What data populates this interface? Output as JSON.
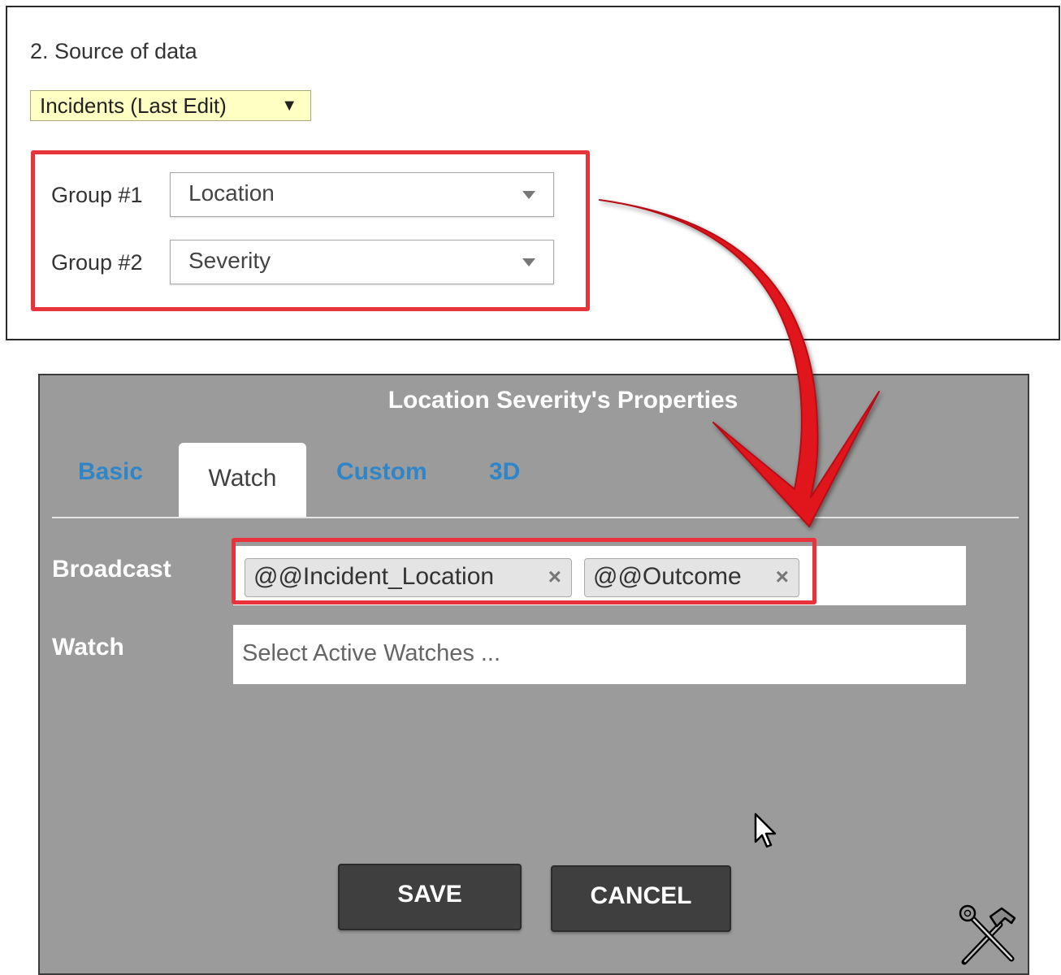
{
  "source_panel": {
    "section_title": "2. Source of data",
    "source_select_value": "Incidents (Last Edit)",
    "source_select_arrow": "▼",
    "group1_label": "Group #1",
    "group1_value": "Location",
    "group2_label": "Group #2",
    "group2_value": "Severity",
    "highlight_color": "#e8333d",
    "source_select_bg": "#ffffc4"
  },
  "dialog": {
    "title": "Location Severity's Properties",
    "tabs": [
      {
        "label": "Basic",
        "active": false
      },
      {
        "label": "Watch",
        "active": true
      },
      {
        "label": "Custom",
        "active": false
      },
      {
        "label": "3D",
        "active": false
      }
    ],
    "tab_color": "#2e86c9",
    "broadcast_label": "Broadcast",
    "broadcast_tags": [
      {
        "label": "@@Incident_Location",
        "remove": "×"
      },
      {
        "label": "@@Outcome",
        "remove": "×"
      }
    ],
    "watch_label": "Watch",
    "watch_placeholder": "Select Active Watches ...",
    "save_label": "SAVE",
    "cancel_label": "CANCEL",
    "background": "#9b9b9b"
  },
  "icons": {
    "cursor": "mouse-pointer-icon",
    "tools": "hammer-wrench-tools-icon",
    "annotation": "curved-red-arrow"
  }
}
